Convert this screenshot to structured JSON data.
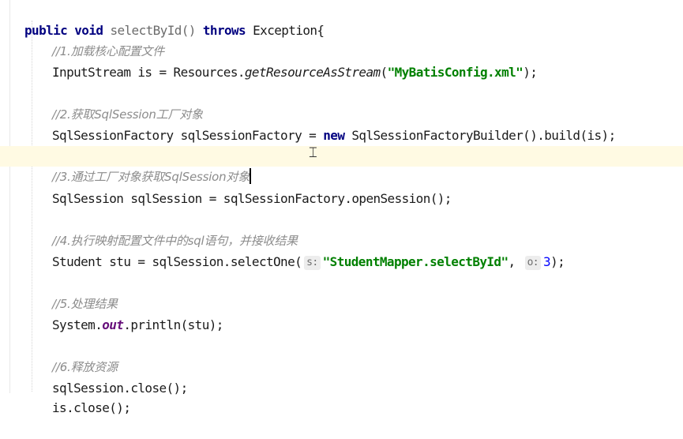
{
  "editor": {
    "method_signature": {
      "kw_public": "public",
      "kw_void": "void",
      "name": "selectById()",
      "kw_throws": "throws",
      "exception": "Exception{"
    },
    "lines": {
      "c1": "//1.加载核心配置文件",
      "l1_a": "InputStream is = Resources.",
      "l1_b": "getResourceAsStream",
      "l1_c": "(",
      "l1_str": "\"MyBatisConfig.xml\"",
      "l1_d": ");",
      "c2": "//2.获取SqlSession工厂对象",
      "l2_a": "SqlSessionFactory sqlSessionFactory = ",
      "l2_new": "new",
      "l2_b": " SqlSessionFactoryBuilder().build(is);",
      "c3": "//3.通过工厂对象获取SqlSession对象",
      "l3": "SqlSession sqlSession = sqlSessionFactory.openSession();",
      "c4": "//4.执行映射配置文件中的sql语句，并接收结果",
      "l4_a": "Student stu = sqlSession.selectOne(",
      "l4_hint_s": "s:",
      "l4_str": "\"StudentMapper.selectById\"",
      "l4_b": ", ",
      "l4_hint_o": "o:",
      "l4_num": "3",
      "l4_c": ");",
      "c5": "//5.处理结果",
      "l5_a": "System.",
      "l5_out": "out",
      "l5_b": ".println(stu);",
      "c6": "//6.释放资源",
      "l6": "sqlSession.close();",
      "l7": "is.close();"
    }
  },
  "colors": {
    "keyword": "#000080",
    "string": "#008000",
    "comment": "#8c8c8c",
    "current_line": "#fffae3"
  },
  "icons": {
    "cursor": "text-ibeam-cursor"
  }
}
